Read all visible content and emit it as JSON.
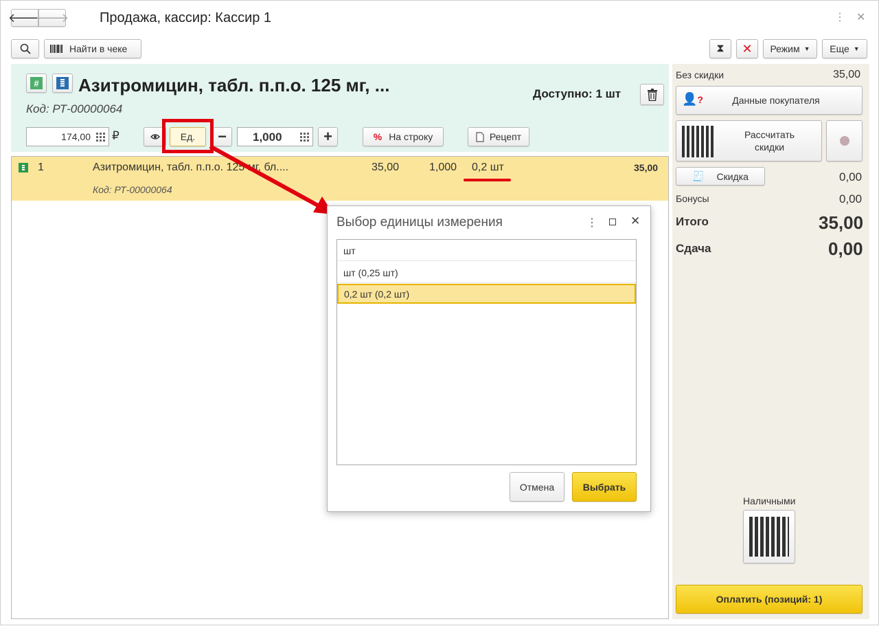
{
  "title": "Продажа, кассир: Кассир 1",
  "toolbar": {
    "find_in_receipt": "Найти в чеке",
    "mode": "Режим",
    "more": "Еще"
  },
  "product": {
    "name": "Азитромицин, табл. п.п.о. 125 мг, ...",
    "code": "Код: РТ-00000064",
    "available": "Доступно: 1 шт",
    "price": "174,00",
    "currency": "₽",
    "unit_button": "Ед.",
    "quantity": "1,000",
    "per_line": "На строку",
    "prescription": "Рецепт"
  },
  "row": {
    "number": "1",
    "name": "Азитромицин, табл. п.п.о. 125 мг, бл....",
    "code": "Код: РТ-00000064",
    "price": "35,00",
    "qty": "1,000",
    "unit": "0,2 шт",
    "sum": "35,00"
  },
  "dialog": {
    "title": "Выбор единицы измерения",
    "items": [
      "шт",
      "шт (0,25 шт)",
      "0,2 шт (0,2 шт)"
    ],
    "cancel": "Отмена",
    "choose": "Выбрать"
  },
  "side": {
    "no_discount_label": "Без скидки",
    "no_discount_value": "35,00",
    "customer_data": "Данные покупателя",
    "calc_discounts": "Рассчитать скидки",
    "discount": "Скидка",
    "discount_value": "0,00",
    "bonuses_label": "Бонусы",
    "bonuses_value": "0,00",
    "total_label": "Итого",
    "total_value": "35,00",
    "change_label": "Сдача",
    "change_value": "0,00",
    "cash": "Наличными",
    "pay": "Оплатить (позиций: 1)"
  },
  "colors": {
    "accent": "#f5d53b",
    "header_bg": "#e4f4ee",
    "row_highlight": "#fbe59a",
    "annotation": "#e0000f",
    "side_bg": "#f2efe6"
  }
}
